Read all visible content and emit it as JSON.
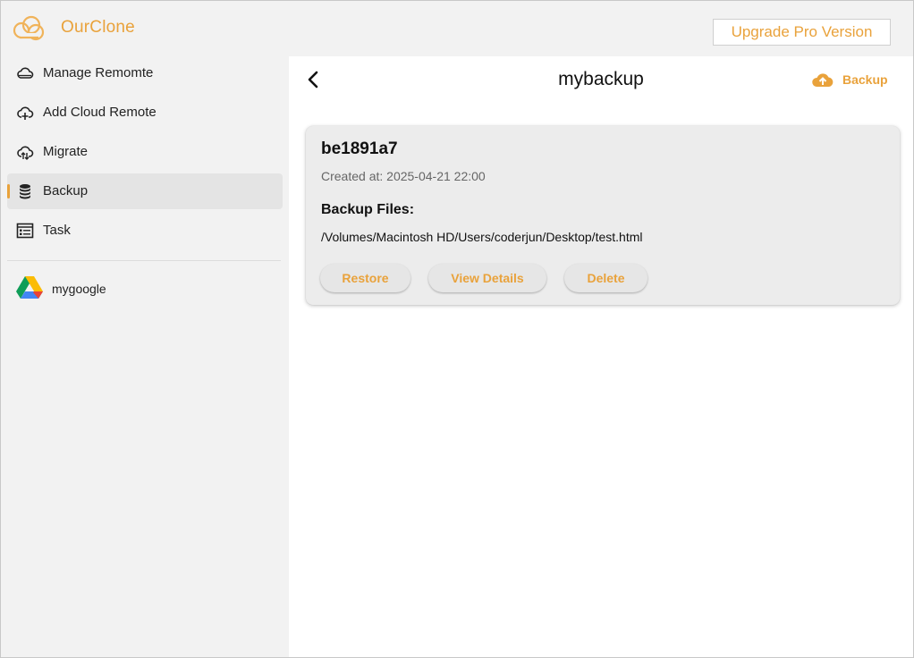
{
  "app": {
    "name": "OurClone",
    "upgrade_label": "Upgrade Pro Version",
    "accent_color": "#e9a23b"
  },
  "sidebar": {
    "items": [
      {
        "label": "Manage Remomte",
        "icon": "cloud-icon"
      },
      {
        "label": "Add Cloud Remote",
        "icon": "cloud-add-icon"
      },
      {
        "label": "Migrate",
        "icon": "cloud-sync-icon"
      },
      {
        "label": "Backup",
        "icon": "database-icon",
        "active": true
      },
      {
        "label": "Task",
        "icon": "task-list-icon"
      }
    ],
    "remotes": [
      {
        "label": "mygoogle",
        "icon": "google-drive-icon"
      }
    ]
  },
  "main": {
    "title": "mybackup",
    "backup_action_label": "Backup",
    "card": {
      "id": "be1891a7",
      "created": "Created at: 2025-04-21 22:00",
      "files_heading": "Backup Files:",
      "file_path": "/Volumes/Macintosh HD/Users/coderjun/Desktop/test.html",
      "actions": {
        "restore": "Restore",
        "details": "View Details",
        "delete": "Delete"
      }
    }
  }
}
